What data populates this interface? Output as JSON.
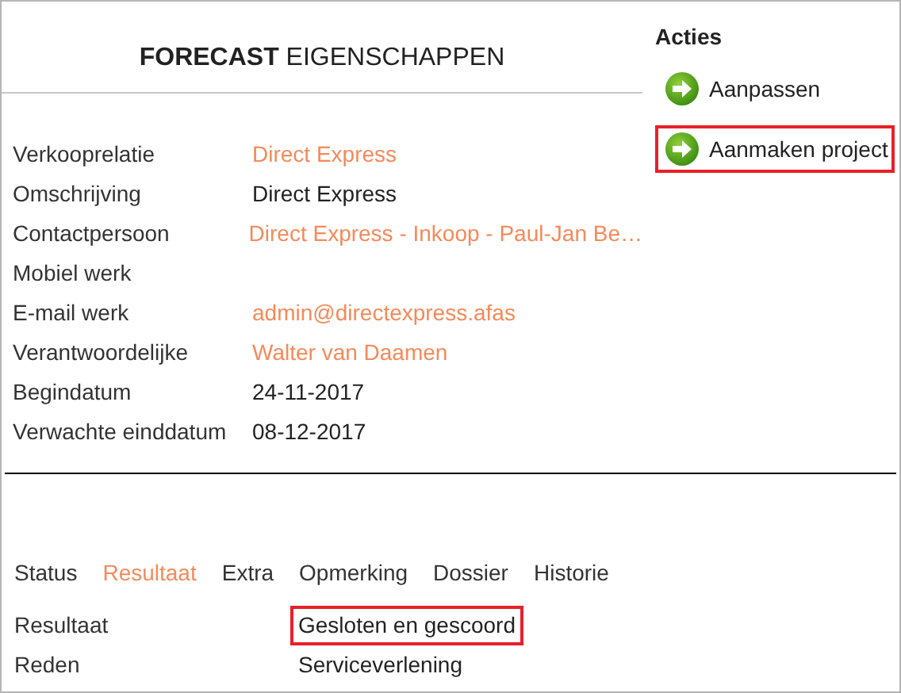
{
  "title": "**FORECAST** EIGENSCHAPPEN",
  "actions": {
    "heading": "Acties",
    "items": [
      {
        "label": "Aanpassen",
        "highlighted": false
      },
      {
        "label": "Aanmaken project",
        "highlighted": true
      }
    ]
  },
  "fields": [
    {
      "label": "Verkooprelatie",
      "value": "Direct Express",
      "link": true
    },
    {
      "label": "Omschrijving",
      "value": "Direct Express",
      "link": false
    },
    {
      "label": "Contactpersoon",
      "value": "Direct Express - Inkoop - Paul-Jan Be…",
      "link": true
    },
    {
      "label": "Mobiel werk"
    },
    {
      "label": "E-mail werk",
      "value": "admin@directexpress.afas",
      "link": true
    },
    {
      "label": "Verantwoordelijke",
      "value": "Walter van Daamen",
      "link": true
    },
    {
      "label": "Begindatum",
      "value": "24-11-2017",
      "link": false
    },
    {
      "label": "Verwachte einddatum",
      "value": "08-12-2017",
      "link": false
    }
  ],
  "tabs": [
    {
      "label": "Status",
      "selected": false
    },
    {
      "label": "Resultaat",
      "selected": true
    },
    {
      "label": "Extra",
      "selected": false
    },
    {
      "label": "Opmerking",
      "selected": false
    },
    {
      "label": "Dossier",
      "selected": false
    },
    {
      "label": "Historie",
      "selected": false
    }
  ],
  "result": [
    {
      "label": "Resultaat",
      "value": "Gesloten en gescoord",
      "highlighted": true
    },
    {
      "label": "Reden",
      "value": "Serviceverlening",
      "highlighted": false
    }
  ]
}
